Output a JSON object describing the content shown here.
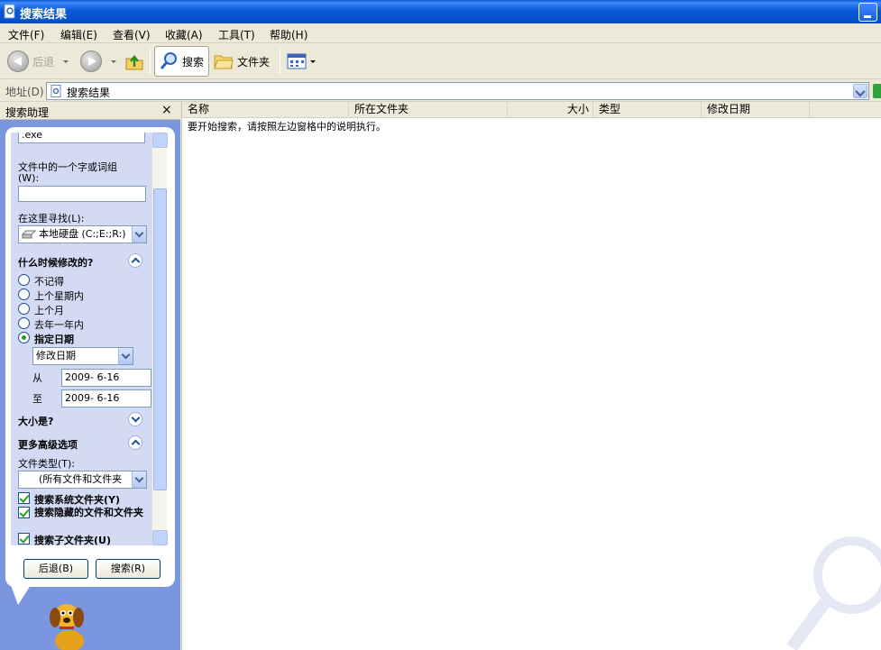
{
  "window": {
    "title": "搜索结果"
  },
  "menu": [
    "文件(F)",
    "编辑(E)",
    "查看(V)",
    "收藏(A)",
    "工具(T)",
    "帮助(H)"
  ],
  "toolbar": {
    "back": "后退",
    "search": "搜索",
    "folders": "文件夹"
  },
  "address": {
    "label": "地址(D)",
    "value": "搜索结果"
  },
  "pane": {
    "title": "搜索助理",
    "close": "×",
    "filename_value": ".exe",
    "word_label_1": "文件中的一个字或词组",
    "word_label_2": "(W):",
    "word_value": "",
    "lookin_label": "在这里寻找(L):",
    "lookin_value": "本地硬盘 (C:;E:;R:)",
    "when_title": "什么时候修改的?",
    "when_options": [
      "不记得",
      "上个星期内",
      "上个月",
      "去年一年内",
      "指定日期"
    ],
    "date_type": "修改日期",
    "from_label": "从",
    "from_value": "2009- 6-16",
    "to_label": "至",
    "to_value": "2009- 6-16",
    "size_title": "大小是?",
    "advanced_title": "更多高级选项",
    "filetype_label": "文件类型(T):",
    "filetype_value": "(所有文件和文件夹",
    "checks": [
      "搜索系统文件夹(Y)",
      "搜索隐藏的文件和文件夹",
      "搜索子文件夹(U)"
    ],
    "back_button": "后退(B)",
    "search_button": "搜索(R)"
  },
  "results": {
    "columns": [
      "名称",
      "所在文件夹",
      "大小",
      "类型",
      "修改日期"
    ],
    "message": "要开始搜索，请按照左边窗格中的说明执行。"
  },
  "colors": {
    "titlebar": "#0a58d8",
    "pane_bg": "#7a96df",
    "pane_inner": "#d3dbf4"
  }
}
